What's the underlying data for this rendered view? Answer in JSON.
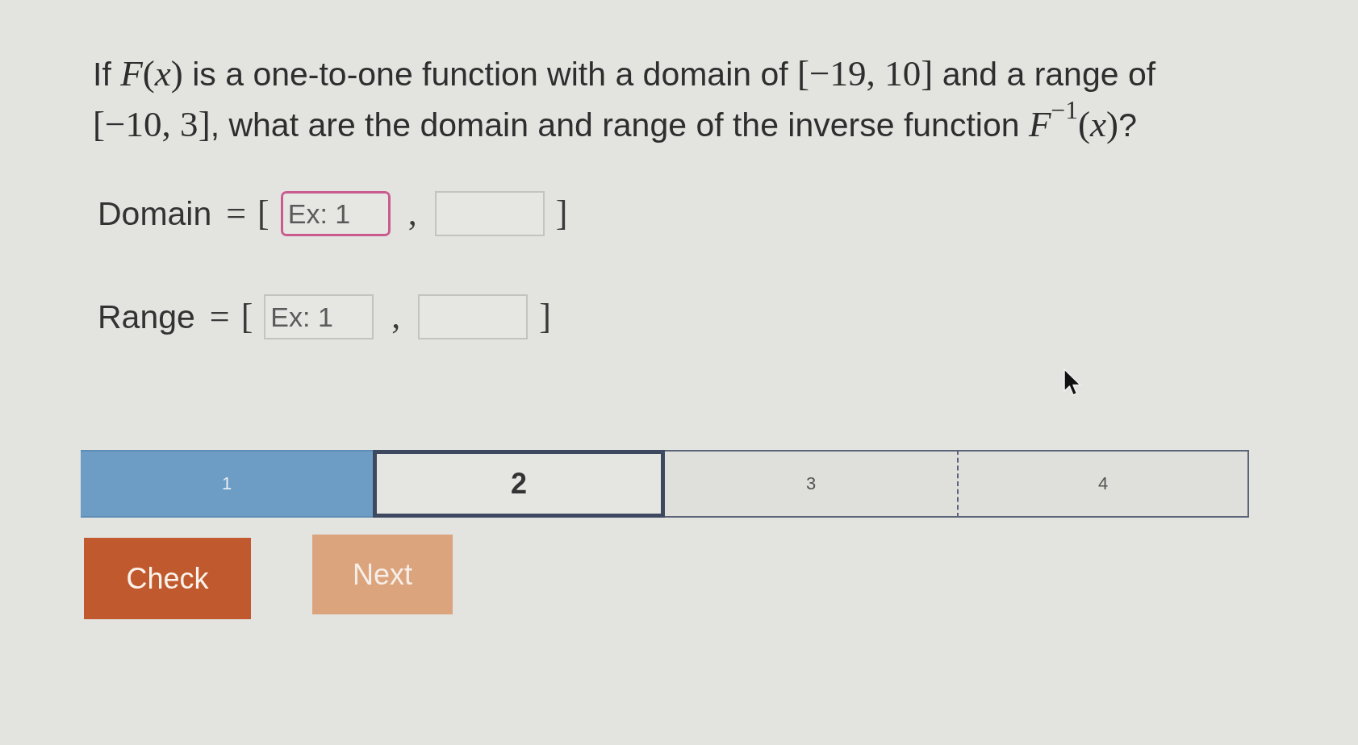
{
  "question": {
    "segments": [
      {
        "kind": "text",
        "text": "If "
      },
      {
        "kind": "math",
        "text": "*F*(*x*)"
      },
      {
        "kind": "text",
        "text": " is a one-to-one function with a domain of "
      },
      {
        "kind": "math",
        "text": "[−19, 10]"
      },
      {
        "kind": "text",
        "text": " and a range of "
      },
      {
        "kind": "math",
        "text": "[−10, 3]"
      },
      {
        "kind": "text",
        "text": ", what are the domain and range of the inverse function "
      },
      {
        "kind": "math",
        "text": "*F*$^{−1}$(*x*)"
      },
      {
        "kind": "text",
        "text": "?"
      }
    ]
  },
  "answer_rows": [
    {
      "label": "Domain",
      "relation": "=",
      "open_bracket": "[",
      "separator": ",",
      "close_bracket": "]",
      "fields": [
        {
          "placeholder": "Ex: 1",
          "focused": true
        },
        {
          "focused": false
        }
      ]
    },
    {
      "label": "Range",
      "relation": "=",
      "open_bracket": "[",
      "separator": ",",
      "close_bracket": "]",
      "fields": [
        {
          "placeholder": "Ex: 1",
          "focused": false
        },
        {
          "focused": false
        }
      ]
    }
  ],
  "progress": [
    {
      "label": "1",
      "completed": true,
      "selected": false
    },
    {
      "label": "2",
      "completed": false,
      "selected": true
    },
    {
      "label": "3",
      "completed": false,
      "selected": false
    },
    {
      "label": "4",
      "completed": false,
      "selected": false
    }
  ],
  "buttons": [
    {
      "label": "Check",
      "disabled": false
    },
    {
      "label": "Next",
      "disabled": true
    }
  ]
}
